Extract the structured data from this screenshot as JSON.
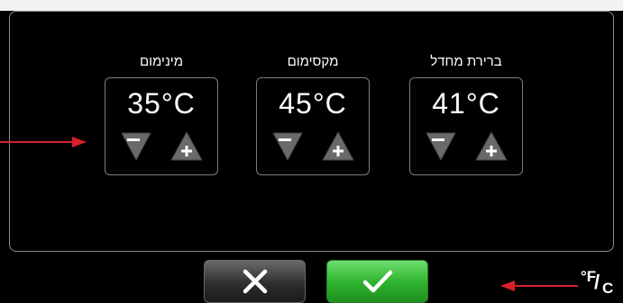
{
  "settings": [
    {
      "id": "minimum",
      "label": "מינימום",
      "value": "35°C"
    },
    {
      "id": "maximum",
      "label": "מקסימום",
      "value": "45°C"
    },
    {
      "id": "default",
      "label": "ברירת מחדל",
      "value": "41°C"
    }
  ],
  "unit_toggle": {
    "degree_f": "°F",
    "slash": "/",
    "c": "C"
  },
  "colors": {
    "accent_green": "#2fb52f",
    "annotation_arrow": "#d8202a"
  },
  "icons": {
    "decrement": "minus-triangle-down-icon",
    "increment": "plus-triangle-up-icon",
    "cancel": "x-icon",
    "confirm": "check-icon"
  }
}
